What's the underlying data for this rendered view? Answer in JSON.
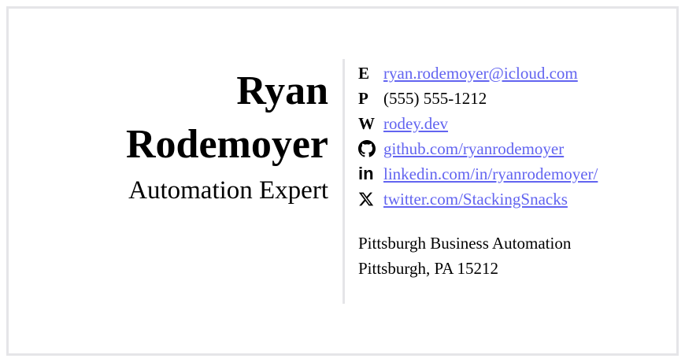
{
  "profile": {
    "first_name": "Ryan",
    "last_name": "Rodemoyer",
    "title": "Automation Expert"
  },
  "contacts": [
    {
      "label": "E",
      "icon": "email-letter",
      "value": "ryan.rodemoyer@icloud.com",
      "link": true
    },
    {
      "label": "P",
      "icon": "phone-letter",
      "value": "(555) 555-1212",
      "link": false
    },
    {
      "label": "W",
      "icon": "website-letter",
      "value": "rodey.dev",
      "link": true
    },
    {
      "label": "",
      "icon": "github-icon",
      "value": "github.com/ryanrodemoyer",
      "link": true
    },
    {
      "label": "",
      "icon": "linkedin-icon",
      "value": "linkedin.com/in/ryanrodemoyer/",
      "link": true
    },
    {
      "label": "",
      "icon": "x-twitter-icon",
      "value": "twitter.com/StackingSnacks",
      "link": true
    }
  ],
  "address": {
    "company": "Pittsburgh Business Automation",
    "city_line": "Pittsburgh, PA 15212"
  },
  "colors": {
    "link": "#6264f0",
    "border": "#e5e5e8"
  }
}
